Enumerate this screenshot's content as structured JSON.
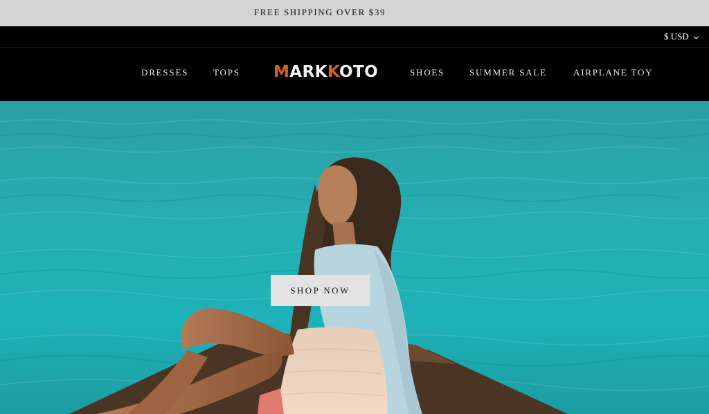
{
  "announcement": {
    "text": "FREE SHIPPING OVER $39"
  },
  "header": {
    "currency": {
      "label": "$ USD"
    },
    "nav_left": [
      "DRESSES",
      "TOPS"
    ],
    "logo": {
      "part1": "M",
      "part2": "ARK",
      "part3": "K",
      "part4": "OTO"
    },
    "nav_right": [
      "SHOES",
      "SUMMER SALE",
      "AIRPLANE TOY"
    ]
  },
  "hero": {
    "cta_label": "SHOP NOW"
  },
  "colors": {
    "announcement_bg": "#d4d4d4",
    "header_bg": "#000000",
    "logo_accent": "#d5621f",
    "sea": "#26adb0",
    "button_bg": "#e3e3e3"
  },
  "icons": [
    "chevron-down-icon"
  ]
}
